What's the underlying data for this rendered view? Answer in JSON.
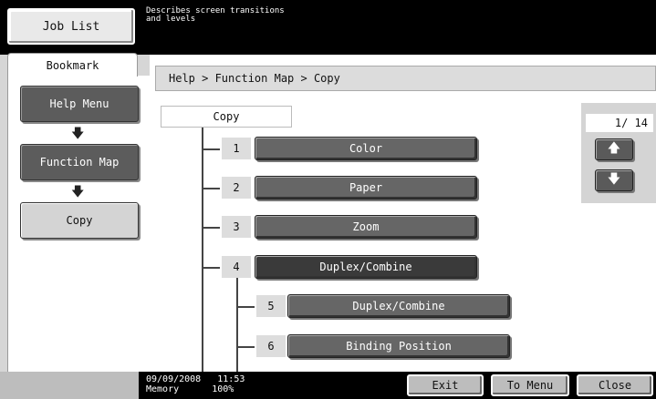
{
  "header": {
    "job_list_label": "Job List",
    "message": "Describes screen transitions\nand levels"
  },
  "bookmark": {
    "tab_label": "Bookmark",
    "items": [
      {
        "label": "Help Menu"
      },
      {
        "label": "Function Map"
      },
      {
        "label": "Copy"
      }
    ],
    "arrow": "🡇"
  },
  "breadcrumb": "Help > Function Map > Copy",
  "tree": {
    "root_label": "Copy",
    "items": [
      {
        "num": "1",
        "label": "Color"
      },
      {
        "num": "2",
        "label": "Paper"
      },
      {
        "num": "3",
        "label": "Zoom"
      },
      {
        "num": "4",
        "label": "Duplex/Combine"
      },
      {
        "num": "5",
        "label": "Duplex/Combine"
      },
      {
        "num": "6",
        "label": "Binding Position"
      }
    ]
  },
  "pager": {
    "indicator": "1/ 14",
    "up_icon": "🡅",
    "down_icon": "🡇"
  },
  "footer": {
    "datetime": "09/09/2008   11:53",
    "memory": "Memory      100%",
    "exit_label": "Exit",
    "to_menu_label": "To Menu",
    "close_label": "Close"
  }
}
